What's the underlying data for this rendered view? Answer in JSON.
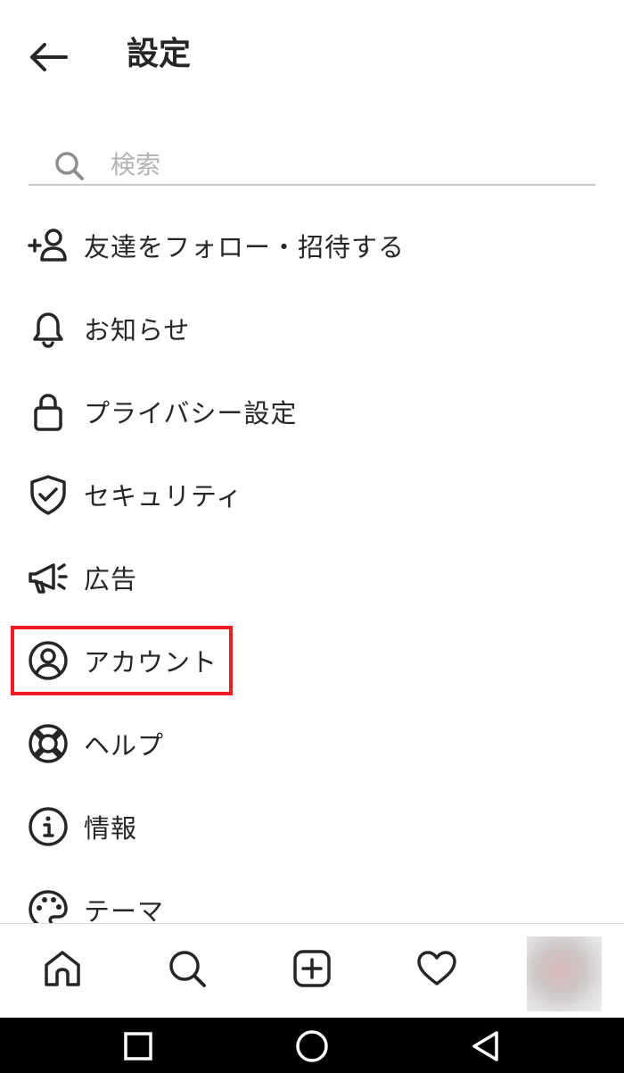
{
  "header": {
    "title": "設定"
  },
  "search": {
    "placeholder": "検索"
  },
  "menu": {
    "items": [
      {
        "label": "友達をフォロー・招待する",
        "icon": "add-person-icon"
      },
      {
        "label": "お知らせ",
        "icon": "bell-icon"
      },
      {
        "label": "プライバシー設定",
        "icon": "lock-icon"
      },
      {
        "label": "セキュリティ",
        "icon": "shield-check-icon"
      },
      {
        "label": "広告",
        "icon": "megaphone-icon"
      },
      {
        "label": "アカウント",
        "icon": "account-circle-icon",
        "highlighted": true
      },
      {
        "label": "ヘルプ",
        "icon": "lifebuoy-icon"
      },
      {
        "label": "情報",
        "icon": "info-icon"
      },
      {
        "label": "テーマ",
        "icon": "palette-icon"
      }
    ]
  },
  "highlight_color": "#ef1c23",
  "tabbar": {
    "items": [
      "home-icon",
      "search-icon",
      "new-post-icon",
      "heart-icon",
      "profile-avatar"
    ]
  },
  "navbar": {
    "items": [
      "recents-square-icon",
      "home-circle-icon",
      "back-triangle-icon"
    ]
  }
}
